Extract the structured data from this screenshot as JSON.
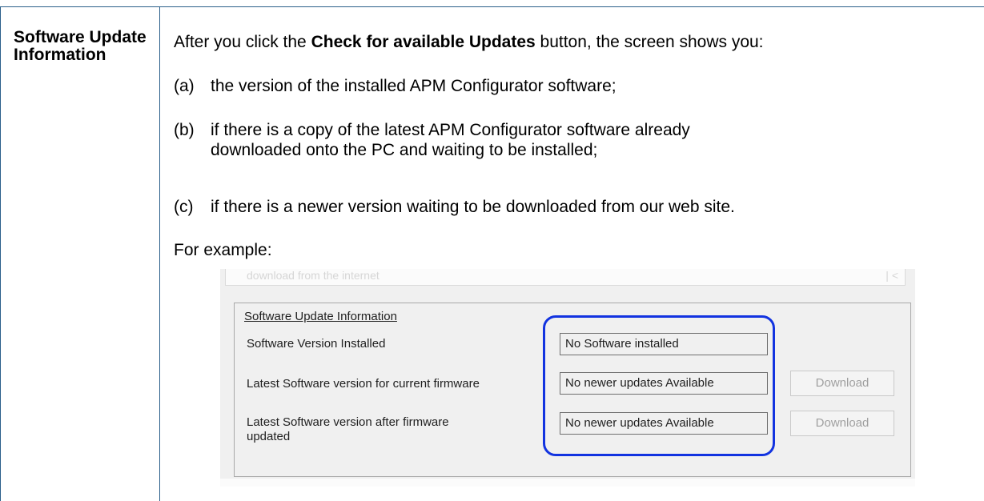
{
  "label": "Software Update Information",
  "intro_before": "After you click the ",
  "intro_bold": "Check for available Updates",
  "intro_after": " button, the screen shows you:",
  "items": [
    {
      "marker": "(a)",
      "text": "the version of the installed APM Configurator software;"
    },
    {
      "marker": "(b)",
      "line1": "if there is a copy of the latest APM Configurator software already",
      "line2": "downloaded onto the PC and waiting to be installed;"
    },
    {
      "marker": "(c)",
      "text": "if there is a newer version waiting to be downloaded from our web site."
    }
  ],
  "example_label": "For example:",
  "screenshot": {
    "faint_text": "download from the internet",
    "group_title": "Software Update Information",
    "rows": [
      {
        "label": "Software Version Installed",
        "value": "No Software installed"
      },
      {
        "label": "Latest Software version for current firmware",
        "value": "No newer updates Available",
        "button": "Download"
      },
      {
        "label_line1": "Latest Software version after firmware",
        "label_line2": "updated",
        "value": "No newer updates Available",
        "button": "Download"
      }
    ]
  }
}
